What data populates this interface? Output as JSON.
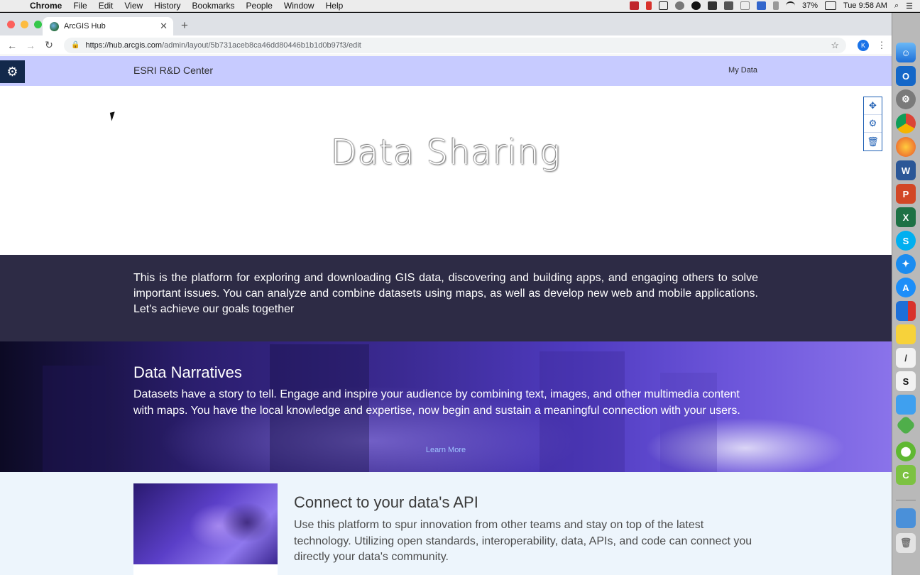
{
  "menubar": {
    "app": "Chrome",
    "items": [
      "File",
      "Edit",
      "View",
      "History",
      "Bookmarks",
      "People",
      "Window",
      "Help"
    ],
    "battery": "37%",
    "clock": "Tue 9:58 AM"
  },
  "browser": {
    "tab_title": "ArcGIS Hub",
    "url_host": "https://hub.arcgis.com",
    "url_path": "/admin/layout/5b731aceb8ca46dd80446b1b1d0b97f3/edit",
    "profile_initial": "K"
  },
  "site": {
    "title": "ESRI R&D Center",
    "nav_link": "My Data"
  },
  "hero": {
    "title": "Data Sharing"
  },
  "intro": {
    "text": "This is the platform for exploring and downloading GIS data, discovering and building apps, and engaging others to solve important issues. You can analyze and combine datasets using maps, as well as develop new web and mobile applications. Let's achieve our goals together"
  },
  "narratives": {
    "title": "Data Narratives",
    "body": "Datasets have a story to tell. Engage and inspire your audience by combining text, images, and other multimedia content with maps. You have the local knowledge and expertise, now begin and sustain a meaningful connection with your users.",
    "link": "Learn More"
  },
  "api": {
    "title": "Connect to your data's API",
    "body": "Use this platform to spur innovation from other teams and stay on top of the latest technology. Utilizing open standards, interoperability, data, APIs, and code can connect you directly your data's community."
  },
  "colors": {
    "header_bg": "#c7cbff",
    "intro_bg": "#2d2b45",
    "gear_box": "#13294b",
    "tool_accent": "#1e5fb4",
    "api_bg": "#edf5fc"
  }
}
